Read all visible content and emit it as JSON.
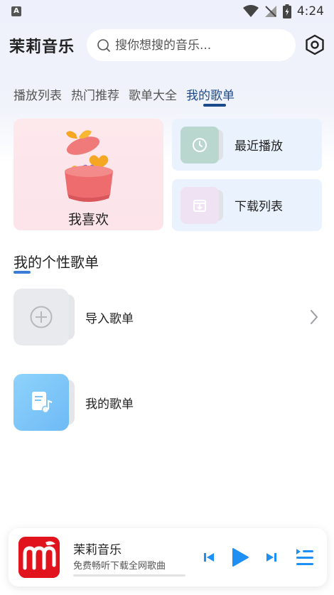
{
  "status": {
    "time": "4:24",
    "app_badge": "A"
  },
  "header": {
    "title": "茉莉音乐",
    "search_placeholder": "搜你想搜的音乐..."
  },
  "tabs": [
    {
      "label": "播放列表",
      "active": false
    },
    {
      "label": "热门推荐",
      "active": false
    },
    {
      "label": "歌单大全",
      "active": false
    },
    {
      "label": "我的歌单",
      "active": true
    }
  ],
  "cards": {
    "favorites": "我喜欢",
    "recent": "最近播放",
    "downloads": "下载列表"
  },
  "section": {
    "title": "我的个性歌单"
  },
  "playlists": [
    {
      "label": "导入歌单",
      "icon": "plus-circle-icon"
    },
    {
      "label": "我的歌单",
      "icon": "music-file-icon"
    }
  ],
  "player": {
    "title": "茉莉音乐",
    "subtitle": "免费畅听下载全网歌曲",
    "progress": 0.0
  },
  "colors": {
    "accent": "#1e90f5",
    "tab_active": "#1a4a8a",
    "brand": "#e1141d"
  }
}
